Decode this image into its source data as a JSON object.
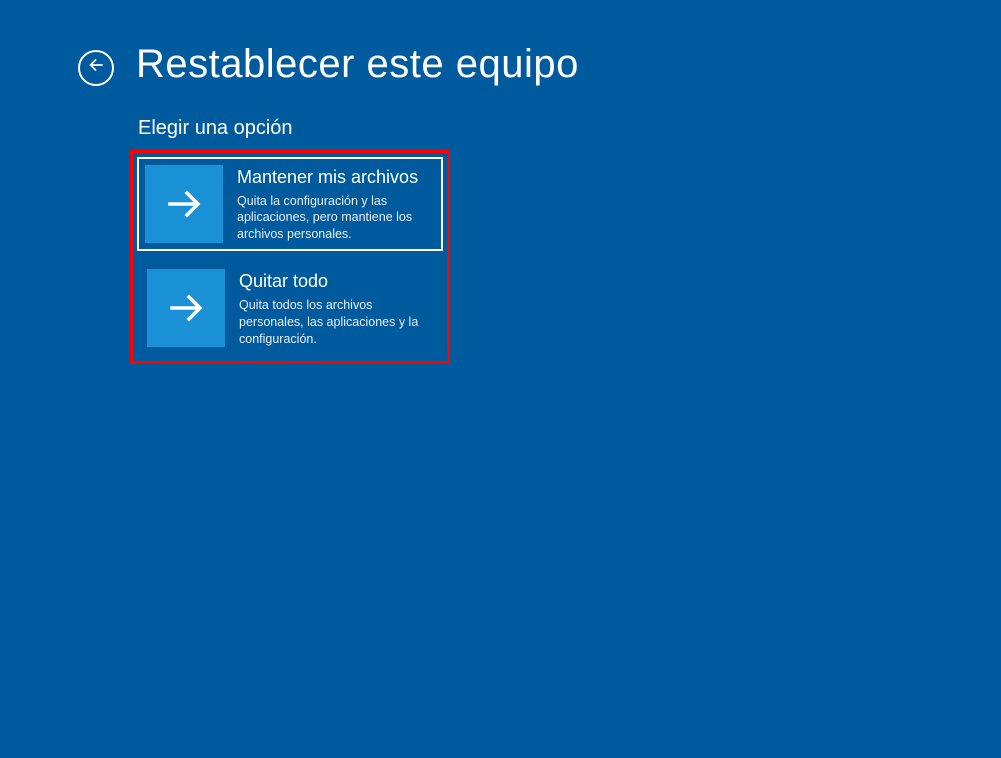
{
  "header": {
    "title": "Restablecer este equipo"
  },
  "subtitle": "Elegir una opción",
  "options": [
    {
      "title": "Mantener mis archivos",
      "description": "Quita la configuración y las aplicaciones, pero mantiene los archivos personales.",
      "selected": true
    },
    {
      "title": "Quitar todo",
      "description": "Quita todos los archivos personales, las aplicaciones y la configuración.",
      "selected": false
    }
  ],
  "colors": {
    "background": "#005a9e",
    "tile_icon_bg": "#1a91d6",
    "highlight_border": "#ff0000"
  }
}
